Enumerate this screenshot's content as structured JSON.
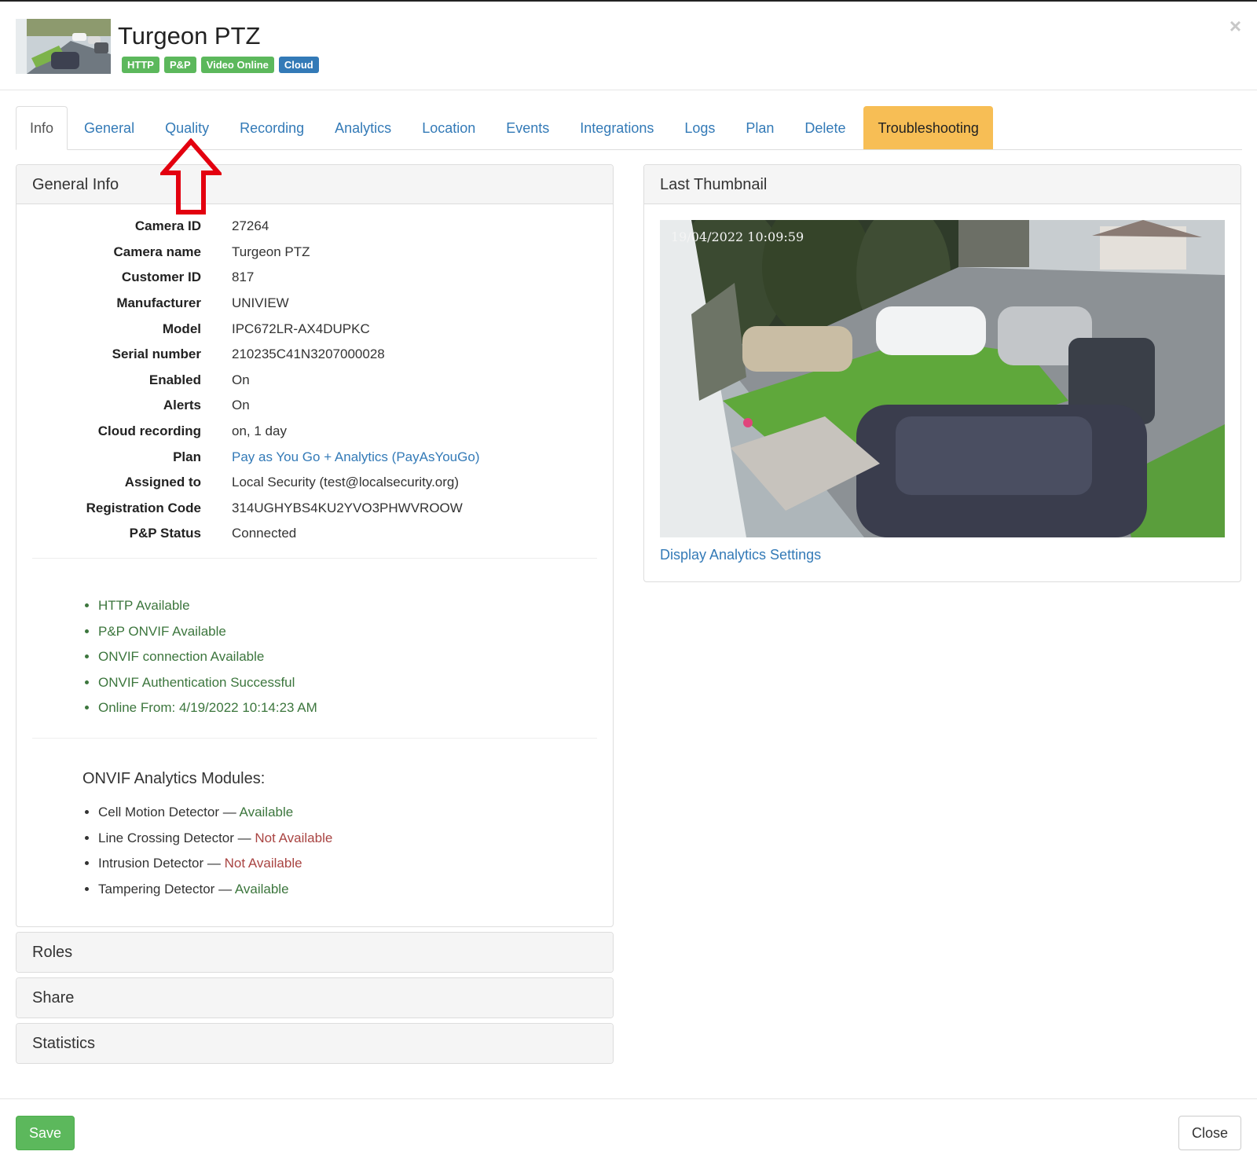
{
  "header": {
    "title": "Turgeon PTZ",
    "badges": [
      {
        "label": "HTTP",
        "color": "#5cb85c"
      },
      {
        "label": "P&P",
        "color": "#5cb85c"
      },
      {
        "label": "Video Online",
        "color": "#5cb85c"
      },
      {
        "label": "Cloud",
        "color": "#337ab7"
      }
    ],
    "close_glyph": "×"
  },
  "tabs": [
    {
      "label": "Info",
      "active": true
    },
    {
      "label": "General"
    },
    {
      "label": "Quality"
    },
    {
      "label": "Recording"
    },
    {
      "label": "Analytics"
    },
    {
      "label": "Location"
    },
    {
      "label": "Events"
    },
    {
      "label": "Integrations"
    },
    {
      "label": "Logs"
    },
    {
      "label": "Plan"
    },
    {
      "label": "Delete"
    },
    {
      "label": "Troubleshooting",
      "highlight_color": "#f7be55"
    }
  ],
  "general_info": {
    "heading": "General Info",
    "fields": [
      {
        "label": "Camera ID",
        "value": "27264"
      },
      {
        "label": "Camera name",
        "value": "Turgeon PTZ"
      },
      {
        "label": "Customer ID",
        "value": "817"
      },
      {
        "label": "Manufacturer",
        "value": "UNIVIEW"
      },
      {
        "label": "Model",
        "value": "IPC672LR-AX4DUPKC"
      },
      {
        "label": "Serial number",
        "value": "210235C41N3207000028"
      },
      {
        "label": "Enabled",
        "value": "On"
      },
      {
        "label": "Alerts",
        "value": "On"
      },
      {
        "label": "Cloud recording",
        "value": "on, 1 day"
      },
      {
        "label": "Plan",
        "value": "Pay as You Go + Analytics (PayAsYouGo)"
      },
      {
        "label": "Assigned to",
        "value": "Local Security (test@localsecurity.org)"
      },
      {
        "label": "Registration Code",
        "value": "314UGHYBS4KU2YVO3PHWVROOW"
      },
      {
        "label": "P&P Status",
        "value": "Connected"
      }
    ],
    "status_items": [
      "HTTP Available",
      "P&P ONVIF Available",
      "ONVIF connection Available",
      "ONVIF Authentication Successful",
      "Online From: 4/19/2022 10:14:23 AM"
    ],
    "modules_title": "ONVIF Analytics Modules:",
    "modules": [
      {
        "name": "Cell Motion Detector",
        "sep": " — ",
        "status": "Available"
      },
      {
        "name": "Line Crossing Detector",
        "sep": " — ",
        "status": "Not Available"
      },
      {
        "name": "Intrusion Detector",
        "sep": " — ",
        "status": "Not Available"
      },
      {
        "name": "Tampering Detector",
        "sep": " — ",
        "status": "Available"
      }
    ]
  },
  "thumbnail": {
    "heading": "Last Thumbnail",
    "timestamp": "19/04/2022 10:09:59",
    "link": "Display Analytics Settings"
  },
  "sections": {
    "roles": "Roles",
    "share": "Share",
    "statistics": "Statistics"
  },
  "footer": {
    "save": "Save",
    "close": "Close"
  },
  "colors": {
    "link": "#337ab7",
    "success": "#3c763d",
    "danger": "#a94442",
    "annotation_arrow": "#e3000f"
  }
}
